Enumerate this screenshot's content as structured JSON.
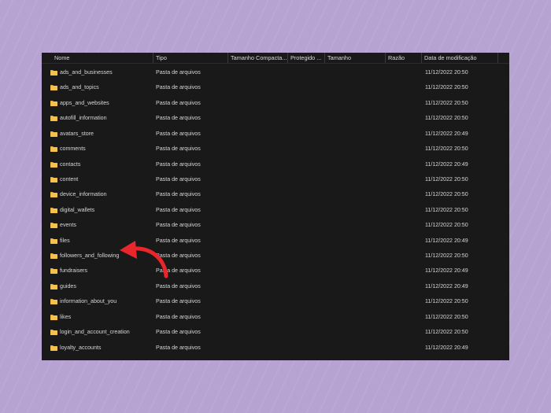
{
  "columns": [
    {
      "key": "name",
      "label": "Nome"
    },
    {
      "key": "type",
      "label": "Tipo"
    },
    {
      "key": "compressed",
      "label": "Tamanho Compacta..."
    },
    {
      "key": "protected",
      "label": "Protegido ..."
    },
    {
      "key": "size",
      "label": "Tamanho"
    },
    {
      "key": "ratio",
      "label": "Razão"
    },
    {
      "key": "modified",
      "label": "Data de modificação"
    }
  ],
  "sort_icon": "chevron-up-icon",
  "folder_color": "#f2c14e",
  "annotation_color": "#e8262b",
  "files": [
    {
      "name": "ads_and_businesses",
      "type": "Pasta de arquivos",
      "modified": "11/12/2022 20:50"
    },
    {
      "name": "ads_and_topics",
      "type": "Pasta de arquivos",
      "modified": "11/12/2022 20:50"
    },
    {
      "name": "apps_and_websites",
      "type": "Pasta de arquivos",
      "modified": "11/12/2022 20:50"
    },
    {
      "name": "autofill_information",
      "type": "Pasta de arquivos",
      "modified": "11/12/2022 20:50"
    },
    {
      "name": "avatars_store",
      "type": "Pasta de arquivos",
      "modified": "11/12/2022 20:49"
    },
    {
      "name": "comments",
      "type": "Pasta de arquivos",
      "modified": "11/12/2022 20:50"
    },
    {
      "name": "contacts",
      "type": "Pasta de arquivos",
      "modified": "11/12/2022 20:49"
    },
    {
      "name": "content",
      "type": "Pasta de arquivos",
      "modified": "11/12/2022 20:50"
    },
    {
      "name": "device_information",
      "type": "Pasta de arquivos",
      "modified": "11/12/2022 20:50"
    },
    {
      "name": "digital_wallets",
      "type": "Pasta de arquivos",
      "modified": "11/12/2022 20:50"
    },
    {
      "name": "events",
      "type": "Pasta de arquivos",
      "modified": "11/12/2022 20:50"
    },
    {
      "name": "files",
      "type": "Pasta de arquivos",
      "modified": "11/12/2022 20:49"
    },
    {
      "name": "followers_and_following",
      "type": "Pasta de arquivos",
      "modified": "11/12/2022 20:50"
    },
    {
      "name": "fundraisers",
      "type": "Pasta de arquivos",
      "modified": "11/12/2022 20:49"
    },
    {
      "name": "guides",
      "type": "Pasta de arquivos",
      "modified": "11/12/2022 20:49"
    },
    {
      "name": "information_about_you",
      "type": "Pasta de arquivos",
      "modified": "11/12/2022 20:50"
    },
    {
      "name": "likes",
      "type": "Pasta de arquivos",
      "modified": "11/12/2022 20:50"
    },
    {
      "name": "login_and_account_creation",
      "type": "Pasta de arquivos",
      "modified": "11/12/2022 20:50"
    },
    {
      "name": "loyalty_accounts",
      "type": "Pasta de arquivos",
      "modified": "11/12/2022 20:49"
    }
  ]
}
